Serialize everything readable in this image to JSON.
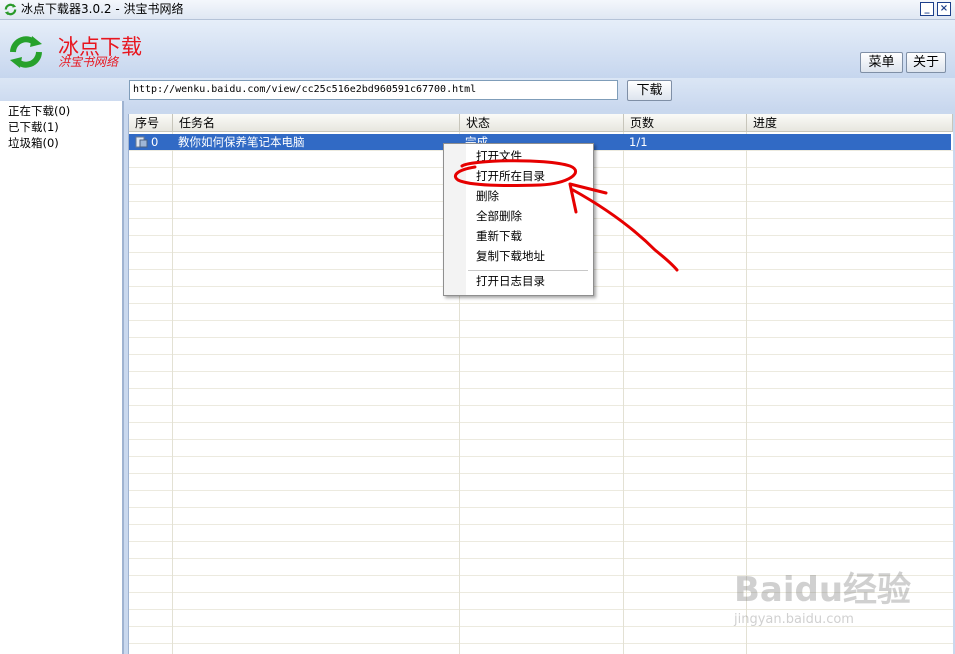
{
  "window": {
    "title": "冰点下载器3.0.2 - 洪宝书网络",
    "minimize_label": "_",
    "close_label": "×"
  },
  "logo": {
    "title": "冰点下载",
    "subtitle": "洪宝书网络"
  },
  "header": {
    "menu_label": "菜单",
    "about_label": "关于"
  },
  "url_bar": {
    "value": "http://wenku.baidu.com/view/cc25c516e2bd960591c67700.html",
    "download_label": "下载"
  },
  "sidebar": {
    "items": [
      {
        "label": "正在下载(0)"
      },
      {
        "label": "已下载(1)"
      },
      {
        "label": "垃圾箱(0)"
      }
    ]
  },
  "table": {
    "columns": [
      "序号",
      "任务名",
      "状态",
      "页数",
      "进度"
    ],
    "rows": [
      {
        "index": "0",
        "name": "教你如何保养笔记本电脑",
        "status": "完成",
        "pages": "1/1",
        "progress": ""
      }
    ]
  },
  "context_menu": {
    "items": [
      {
        "label": "打开文件"
      },
      {
        "label": "打开所在目录"
      },
      {
        "label": "删除"
      },
      {
        "label": "全部删除"
      },
      {
        "label": "重新下载"
      },
      {
        "label": "复制下载地址"
      },
      {
        "label": "打开日志目录"
      }
    ]
  },
  "watermark": {
    "text": "Baidu经验",
    "url": "jingyan.baidu.com"
  },
  "colors": {
    "selection": "#316ac5",
    "annotation_red": "#e60000",
    "logo_red": "#e8161f"
  }
}
